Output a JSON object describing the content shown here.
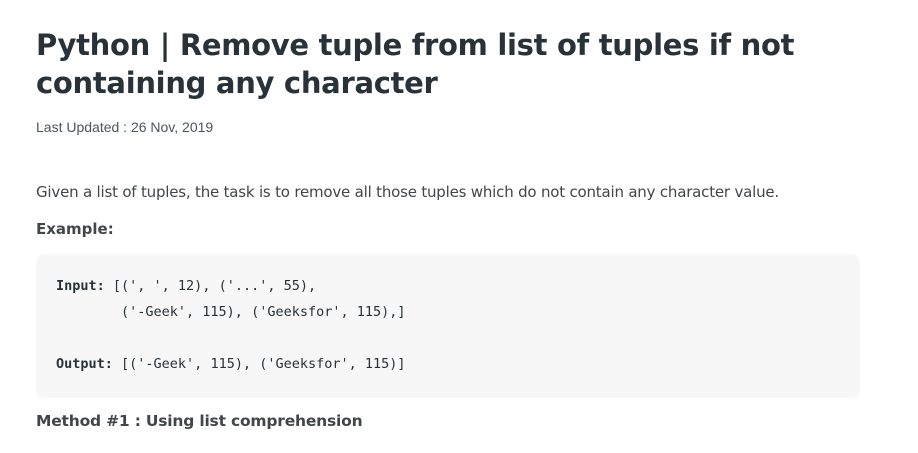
{
  "article": {
    "title": "Python | Remove tuple from list of tuples if not containing any character",
    "last_updated": "Last Updated : 26 Nov, 2019",
    "intro": "Given a list of tuples, the task is to remove all those tuples which do not contain any character value.",
    "example_heading": "Example:",
    "code": {
      "input_label": "Input:",
      "input_line1": " [(', ', 12), ('...', 55),",
      "input_line2": "        ('-Geek', 115), ('Geeksfor', 115),]",
      "output_label": "Output:",
      "output_line": " [('-Geek', 115), ('Geeksfor', 115)]"
    },
    "method_heading": "Method #1 : Using list comprehension"
  }
}
